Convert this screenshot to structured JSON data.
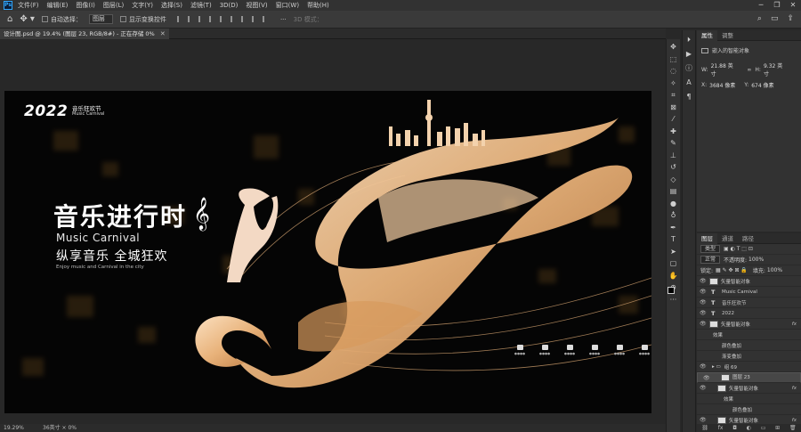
{
  "menu": [
    "文件(F)",
    "编辑(E)",
    "图像(I)",
    "图层(L)",
    "文字(Y)",
    "选择(S)",
    "滤镜(T)",
    "3D(D)",
    "视图(V)",
    "窗口(W)",
    "帮助(H)"
  ],
  "options": {
    "auto_select_label": "自动选择：",
    "auto_select_value": "图层",
    "show_transform_label": "显示变换控件",
    "mode_label": "3D 模式："
  },
  "document_tab": "设计图.psd @ 19.4% (图层 23, RGB/8#) - 正在存储 0%",
  "artwork": {
    "year": "2022",
    "brand_cn": "音乐狂欢节",
    "brand_en": "Music Carnival",
    "headline": "音乐进行时",
    "sub_en": "Music Carnival",
    "sub_cn": "纵享音乐 全城狂欢",
    "sub_small": "Enjoy music and Carnival in the city",
    "accent_color": "#e8b27a",
    "sponsors": [
      "●●●●",
      "●●●●",
      "●●●●",
      "●●●●",
      "●●●●",
      "●●●●"
    ]
  },
  "status": {
    "zoom": "19.29%",
    "info": "36英寸 × 0%"
  },
  "properties": {
    "tabs": [
      "属性",
      "调整"
    ],
    "section": "嵌入的智能对象",
    "w_label": "W:",
    "w_value": "21.88 英寸",
    "h_label": "H:",
    "h_value": "9.32 英寸",
    "x_label": "X:",
    "x_value": "3684 像素",
    "y_label": "Y:",
    "y_value": "674 像素"
  },
  "layers": {
    "tabs": [
      "图层",
      "通道",
      "路径"
    ],
    "filter_kind": "类型",
    "blend_mode": "正常",
    "opacity_label": "不透明度:",
    "opacity_value": "100%",
    "lock_label": "锁定:",
    "fill_label": "填充:",
    "fill_value": "100%",
    "items": [
      {
        "name": "矢量智能对象",
        "kind": "smart"
      },
      {
        "name": "Music Carnival",
        "kind": "text"
      },
      {
        "name": "音乐狂欢节",
        "kind": "text"
      },
      {
        "name": "2022",
        "kind": "text"
      },
      {
        "name": "矢量智能对象",
        "kind": "smart",
        "fx": "fx"
      },
      {
        "name": "效果",
        "kind": "effects"
      },
      {
        "name": "颜色叠加",
        "kind": "effect"
      },
      {
        "name": "渐变叠加",
        "kind": "effect"
      },
      {
        "name": "组 69",
        "kind": "group"
      },
      {
        "name": "图层 23",
        "kind": "pixel",
        "selected": true
      },
      {
        "name": "矢量智能对象",
        "kind": "smart",
        "fx": "fx"
      },
      {
        "name": "效果",
        "kind": "effects"
      },
      {
        "name": "颜色叠加",
        "kind": "effect"
      },
      {
        "name": "矢量智能对象",
        "kind": "smart",
        "fx": "fx"
      },
      {
        "name": "效果",
        "kind": "effects"
      }
    ]
  },
  "tools": [
    "move-tool",
    "artboard-tool",
    "marquee-tool",
    "lasso-tool",
    "magic-wand-tool",
    "crop-tool",
    "frame-tool",
    "eyedropper-tool",
    "healing-tool",
    "brush-tool",
    "stamp-tool",
    "history-brush-tool",
    "eraser-tool",
    "gradient-tool",
    "blur-tool",
    "dodge-tool",
    "pen-tool",
    "type-tool",
    "path-select-tool",
    "rectangle-tool",
    "hand-tool",
    "zoom-tool",
    "more-tools"
  ]
}
